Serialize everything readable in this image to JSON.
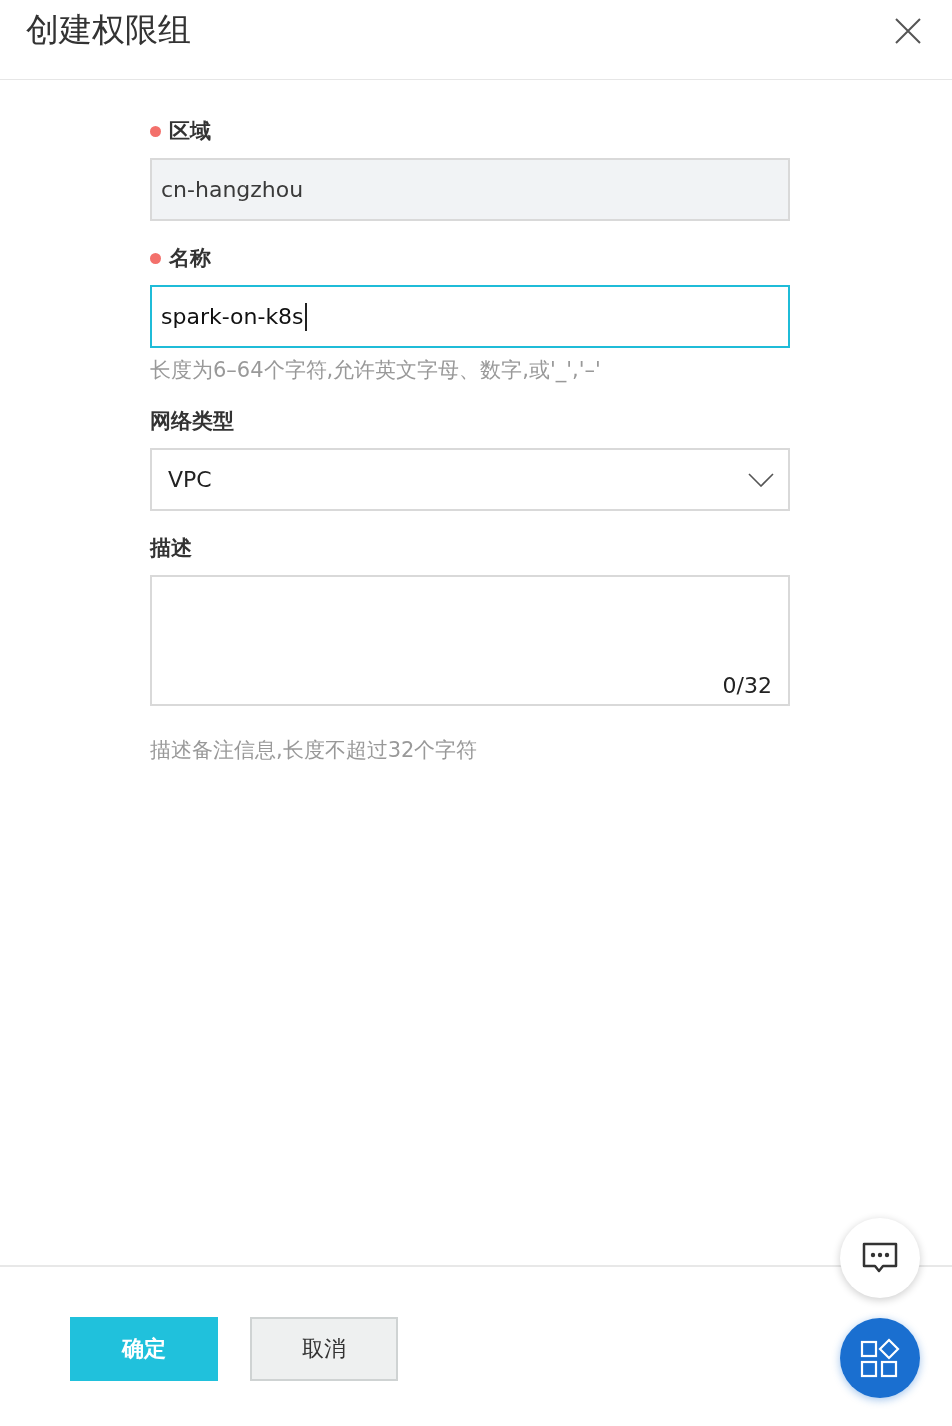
{
  "dialog": {
    "title": "创建权限组"
  },
  "fields": [
    {
      "kind": "text",
      "label": "区域",
      "required": true,
      "value": "cn-hangzhou",
      "disabled": true,
      "focused": false
    },
    {
      "kind": "text",
      "label": "名称",
      "required": true,
      "value": "spark-on-k8s",
      "disabled": false,
      "focused": true,
      "hint": "长度为6–64个字符,允许英文字母、数字,或'_','–'"
    },
    {
      "kind": "select",
      "label": "网络类型",
      "required": false,
      "value": "VPC"
    },
    {
      "kind": "textarea",
      "label": "描述",
      "required": false,
      "counter": "0/32",
      "hint": "描述备注信息,长度不超过32个字符"
    }
  ],
  "buttons": [
    {
      "label": "确定",
      "kind": "primary"
    },
    {
      "label": "取消",
      "kind": "secondary"
    }
  ]
}
